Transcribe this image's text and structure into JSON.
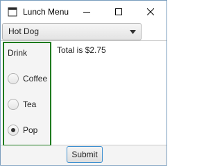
{
  "window": {
    "title": "Lunch Menu"
  },
  "menu_select": {
    "value": "Hot Dog"
  },
  "drink_group": {
    "label": "Drink",
    "options": [
      {
        "label": "Coffee",
        "selected": false
      },
      {
        "label": "Tea",
        "selected": false
      },
      {
        "label": "Pop",
        "selected": true
      }
    ]
  },
  "total": {
    "text": "Total is $2.75"
  },
  "actions": {
    "submit_label": "Submit"
  },
  "colors": {
    "group_border": "#1e7a1e",
    "focus_border": "#3c8fd0"
  }
}
